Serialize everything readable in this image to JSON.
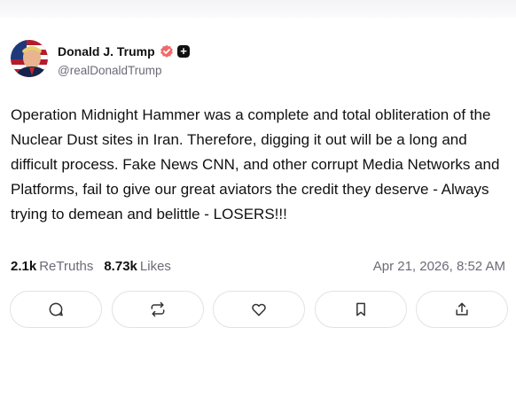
{
  "author": {
    "name": "Donald J. Trump",
    "handle": "@realDonaldTrump",
    "plus_badge": "+"
  },
  "post": {
    "text": "Operation Midnight Hammer was a complete and total obliteration of the Nuclear Dust sites in Iran. Therefore, digging it out will be a long and difficult process. Fake News CNN, and other corrupt Media Networks and Platforms, fail to give our great aviators the credit they deserve - Always trying to demean and belittle - LOSERS!!!",
    "retruths_count": "2.1k",
    "retruths_label": "ReTruths",
    "likes_count": "8.73k",
    "likes_label": "Likes",
    "timestamp": "Apr 21, 2026, 8:52 AM"
  },
  "actions": [
    {
      "icon": "reply-icon"
    },
    {
      "icon": "retruth-icon"
    },
    {
      "icon": "like-icon"
    },
    {
      "icon": "bookmark-icon"
    },
    {
      "icon": "share-icon"
    }
  ],
  "colors": {
    "verified_badge": "#f06a6a",
    "text": "#111111",
    "muted": "#6b6b78",
    "border": "#e2e2e6"
  }
}
